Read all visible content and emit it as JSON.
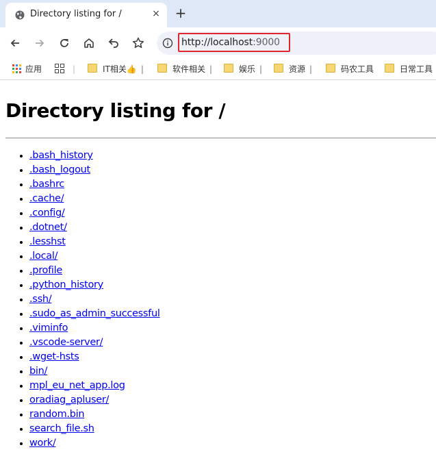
{
  "browser": {
    "tab_title": "Directory listing for /",
    "tab_close": "×",
    "new_tab": "+",
    "url": {
      "host": "http://localhost",
      "port": ":9000"
    },
    "bookmarks": [
      {
        "label": "应用",
        "type": "apps"
      },
      {
        "label": "",
        "type": "grid"
      },
      {
        "label": "IT相关👍",
        "type": "folder"
      },
      {
        "label": "软件相关",
        "type": "folder"
      },
      {
        "label": "娱乐",
        "type": "folder"
      },
      {
        "label": "资源",
        "type": "folder"
      },
      {
        "label": "码农工具",
        "type": "folder"
      },
      {
        "label": "日常工具",
        "type": "folder"
      }
    ],
    "bookmark_separator": "|"
  },
  "page": {
    "heading": "Directory listing for /",
    "files": [
      ".bash_history",
      ".bash_logout",
      ".bashrc",
      ".cache/",
      ".config/",
      ".dotnet/",
      ".lesshst",
      ".local/",
      ".profile",
      ".python_history",
      ".ssh/",
      ".sudo_as_admin_successful",
      ".viminfo",
      ".vscode-server/",
      ".wget-hsts",
      "bin/",
      "mpl_eu_net_app.log",
      "oradiag_apluser/",
      "random.bin",
      "search_file.sh",
      "work/"
    ]
  },
  "colors": {
    "highlight": "#e0262f",
    "link": "#0000ee",
    "tabstrip": "#dfe8f7"
  }
}
